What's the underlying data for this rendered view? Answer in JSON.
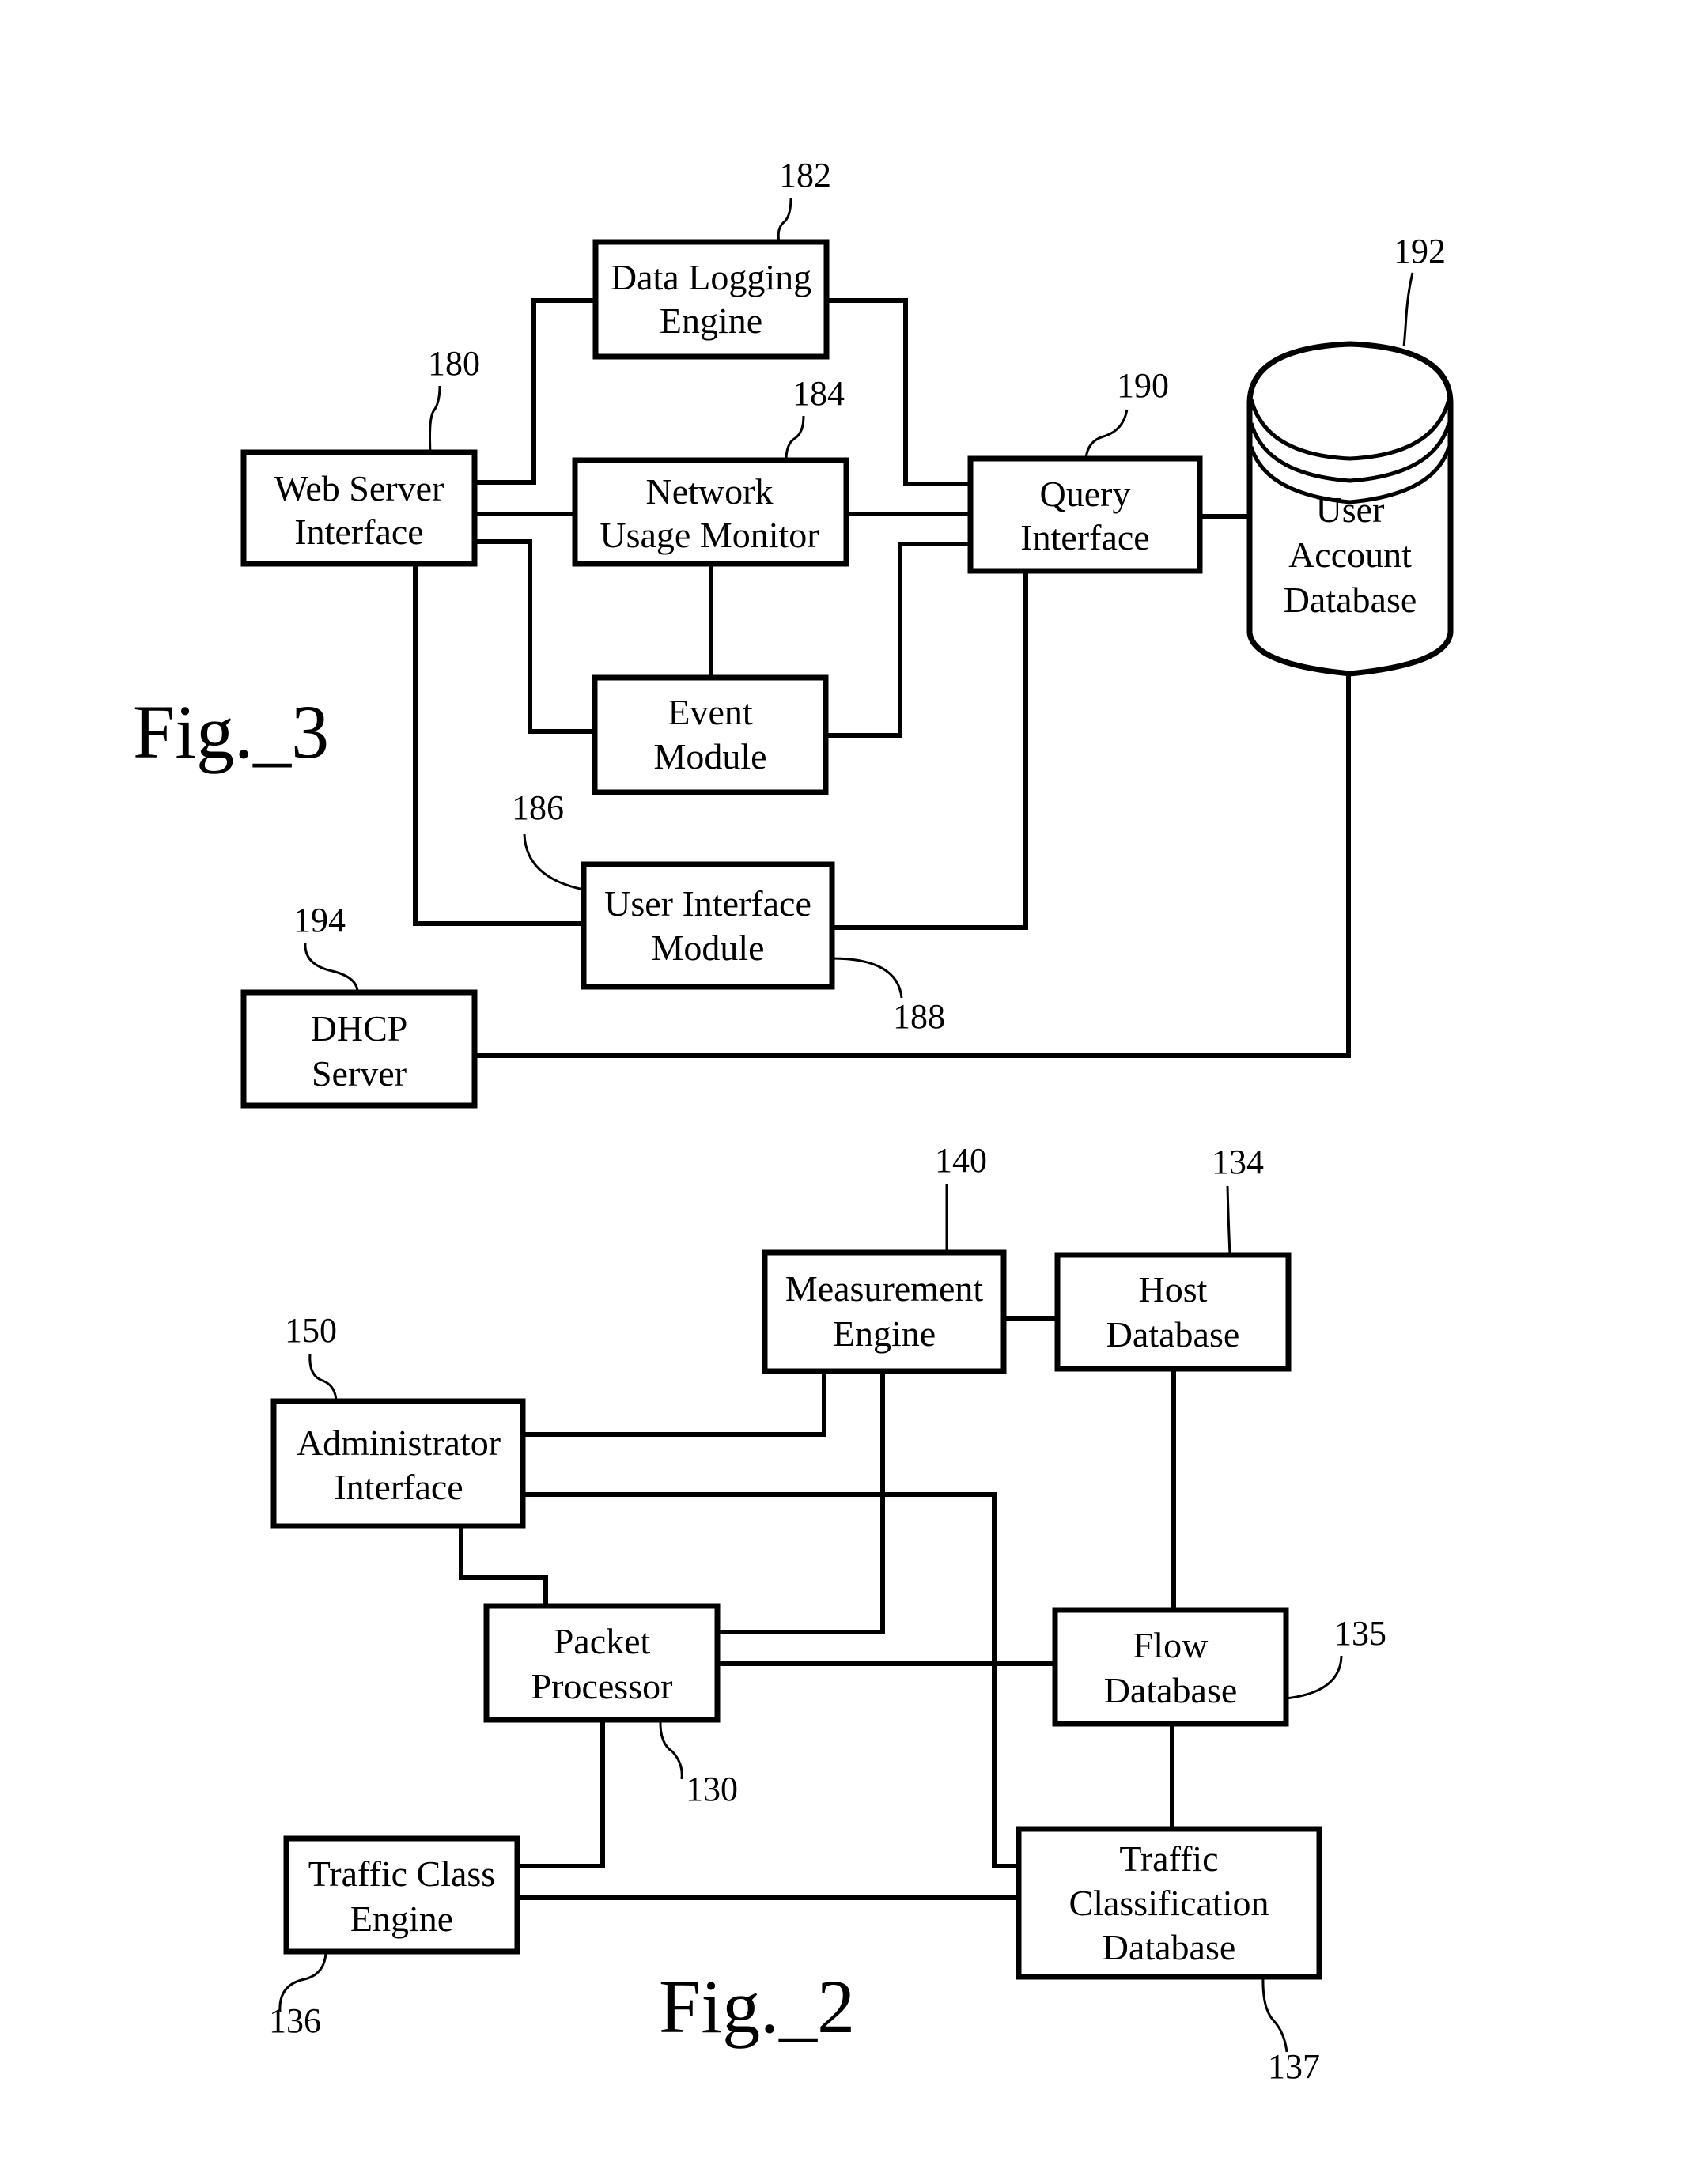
{
  "figures": [
    {
      "id": "fig3",
      "caption": "Fig._3",
      "blocks": [
        {
          "ref": "180",
          "lines": [
            "Web Server",
            "Interface"
          ]
        },
        {
          "ref": "182",
          "lines": [
            "Data Logging",
            "Engine"
          ]
        },
        {
          "ref": "184",
          "lines": [
            "Network",
            "Usage Monitor"
          ]
        },
        {
          "ref": "190",
          "lines": [
            "Query",
            "Interface"
          ]
        },
        {
          "ref": "",
          "lines": [
            "Event",
            "Module"
          ]
        },
        {
          "ref": "186",
          "lines": [
            "User Interface",
            "Module"
          ]
        },
        {
          "ref": "194",
          "lines": [
            "DHCP",
            "Server"
          ]
        },
        {
          "ref": "192",
          "lines": [
            "User",
            "Account",
            "Database"
          ],
          "shape": "cylinder"
        }
      ],
      "extra_refs": [
        "188"
      ]
    },
    {
      "id": "fig2",
      "caption": "Fig._2",
      "blocks": [
        {
          "ref": "140",
          "lines": [
            "Measurement",
            "Engine"
          ]
        },
        {
          "ref": "134",
          "lines": [
            "Host",
            "Database"
          ]
        },
        {
          "ref": "150",
          "lines": [
            "Administrator",
            "Interface"
          ]
        },
        {
          "ref": "130",
          "lines": [
            "Packet",
            "Processor"
          ]
        },
        {
          "ref": "135",
          "lines": [
            "Flow",
            "Database"
          ]
        },
        {
          "ref": "136",
          "lines": [
            "Traffic Class",
            "Engine"
          ]
        },
        {
          "ref": "137",
          "lines": [
            "Traffic",
            "Classification",
            "Database"
          ]
        }
      ]
    }
  ]
}
